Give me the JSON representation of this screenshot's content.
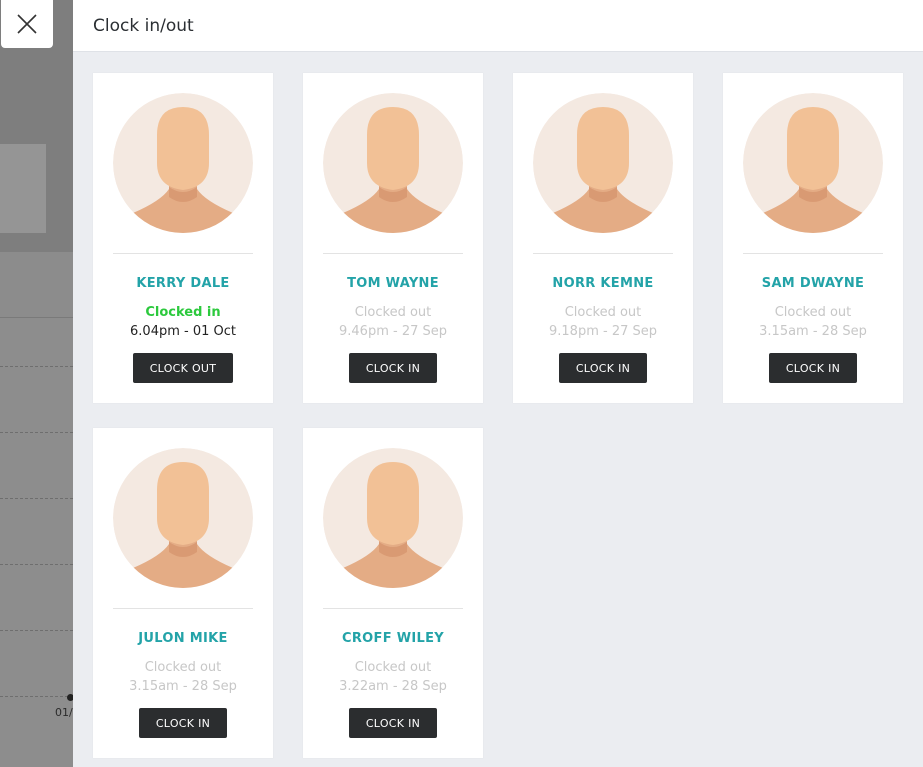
{
  "panel": {
    "title": "Clock in/out"
  },
  "background": {
    "axis_label": "01/"
  },
  "colors": {
    "name": "#23a3a8",
    "clocked_in": "#2cc93d",
    "muted": "#c7c7c7",
    "button_bg": "#2b2d2f"
  },
  "employees": [
    {
      "name": "KERRY DALE",
      "status": "Clocked in",
      "time": "6.04pm - 01 Oct",
      "button": "CLOCK OUT"
    },
    {
      "name": "TOM WAYNE",
      "status": "Clocked out",
      "time": "9.46pm - 27 Sep",
      "button": "CLOCK IN"
    },
    {
      "name": "NORR KEMNE",
      "status": "Clocked out",
      "time": "9.18pm - 27 Sep",
      "button": "CLOCK IN"
    },
    {
      "name": "SAM DWAYNE",
      "status": "Clocked out",
      "time": "3.15am - 28 Sep",
      "button": "CLOCK IN"
    },
    {
      "name": "JULON MIKE",
      "status": "Clocked out",
      "time": "3.15am - 28 Sep",
      "button": "CLOCK IN"
    },
    {
      "name": "CROFF WILEY",
      "status": "Clocked out",
      "time": "3.22am - 28 Sep",
      "button": "CLOCK IN"
    }
  ]
}
